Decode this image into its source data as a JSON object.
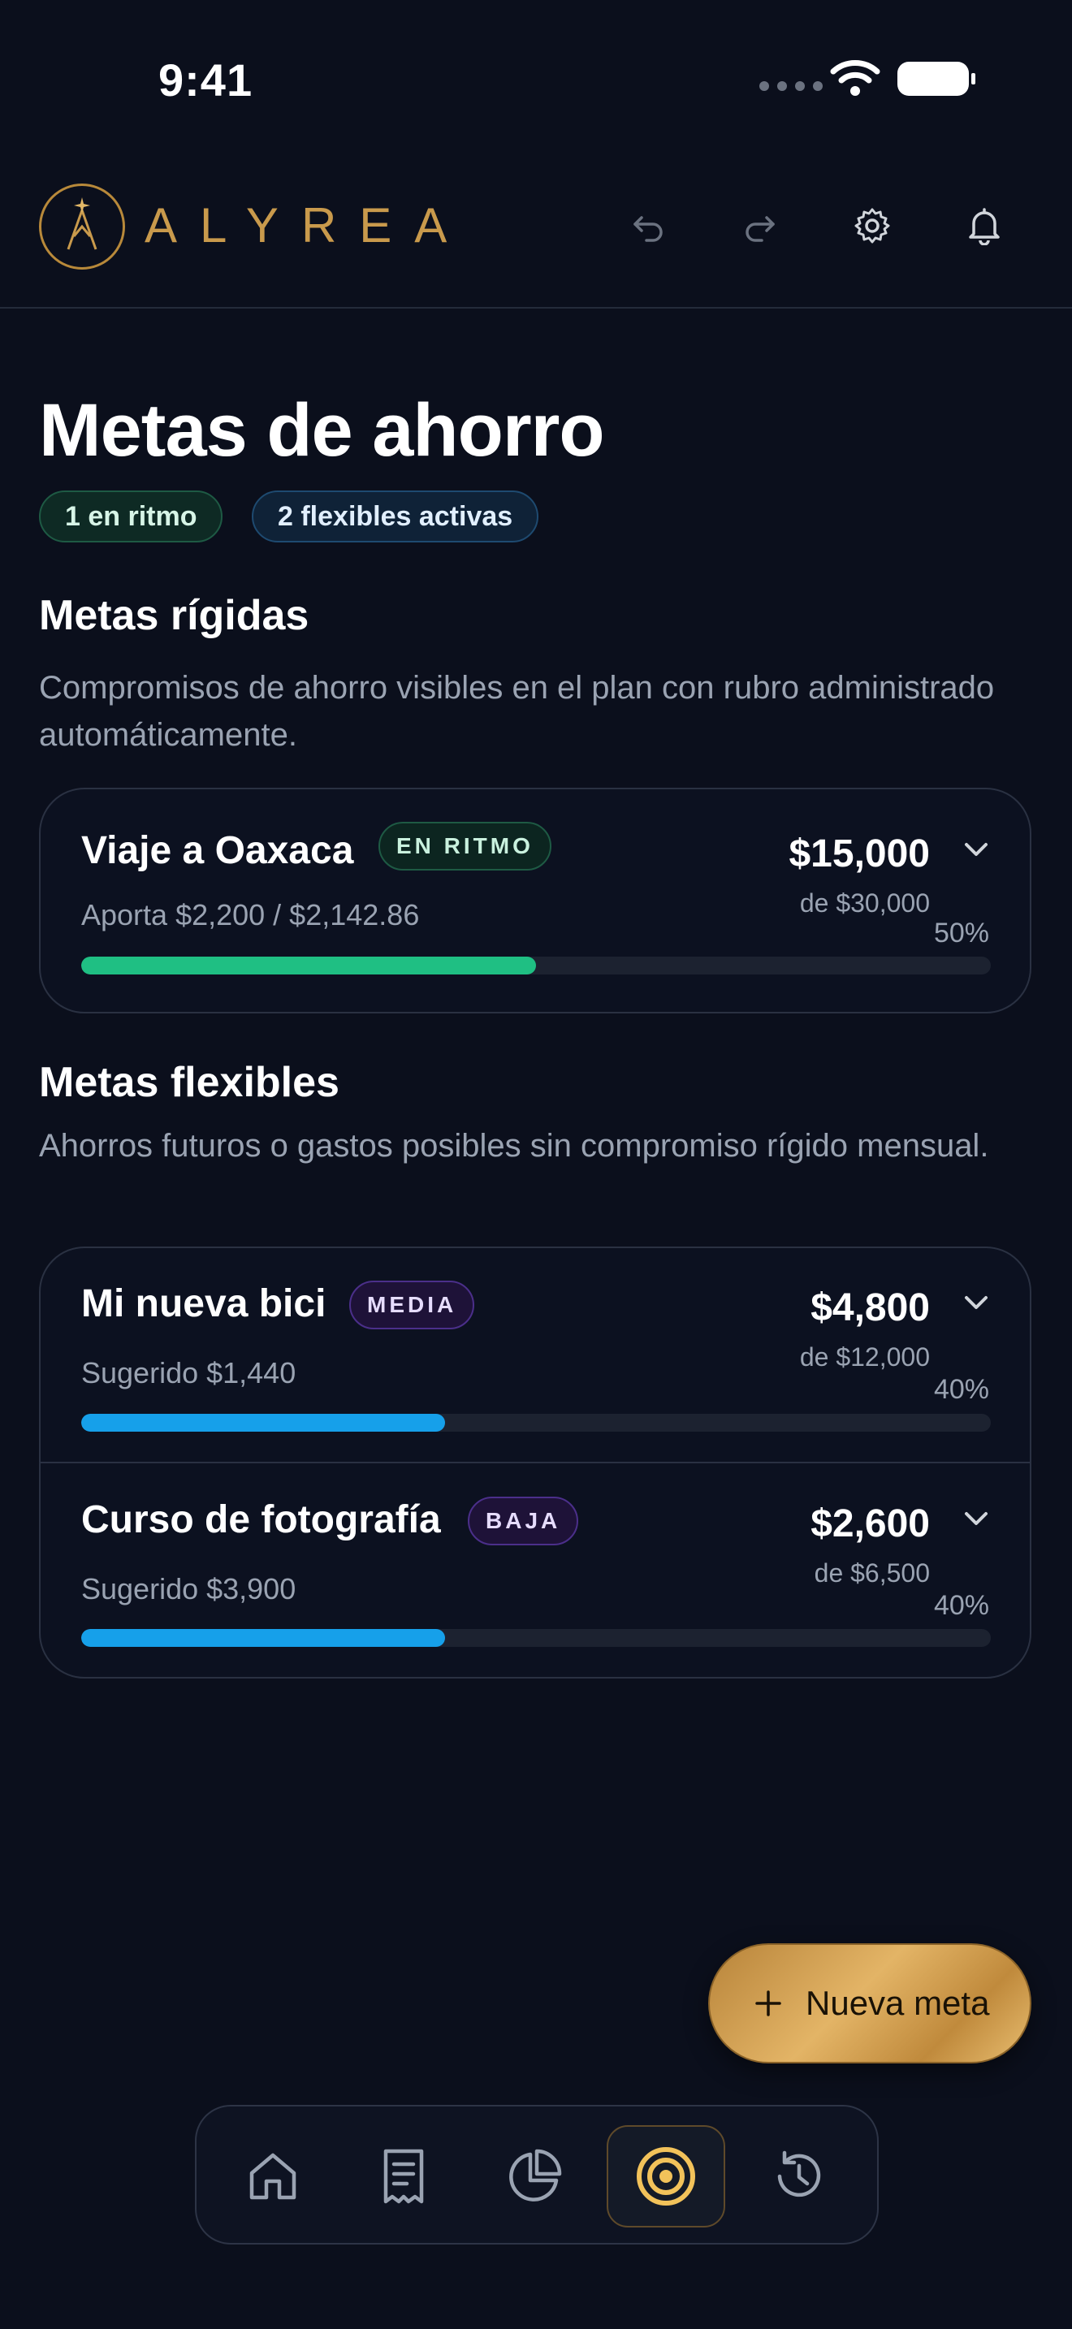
{
  "status_bar": {
    "time": "9:41"
  },
  "header": {
    "brand": "ALYREA"
  },
  "page": {
    "title": "Metas de ahorro",
    "chips": {
      "on_track": "1 en ritmo",
      "flexible_active": "2 flexibles activas"
    }
  },
  "rigid": {
    "title": "Metas rígidas",
    "description": "Compromisos de ahorro visibles en el plan con rubro administrado automáticamente.",
    "goals": [
      {
        "name": "Viaje a Oaxaca",
        "badge": "EN RITMO",
        "detail": "Aporta $2,200 / $2,142.86",
        "amount": "$15,000",
        "target": "de $30,000",
        "percent": "50%",
        "progress": 0.5,
        "bar_color": "#1fbf83"
      }
    ]
  },
  "flexible": {
    "title": "Metas flexibles",
    "description": "Ahorros futuros o gastos posibles sin compromiso rígido mensual.",
    "goals": [
      {
        "name": "Mi nueva bici",
        "badge": "MEDIA",
        "detail": "Sugerido $1,440",
        "amount": "$4,800",
        "target": "de $12,000",
        "percent": "40%",
        "progress": 0.4,
        "bar_color": "#16a0ea"
      },
      {
        "name": "Curso de fotografía",
        "badge": "BAJA",
        "detail": "Sugerido $3,900",
        "amount": "$2,600",
        "target": "de $6,500",
        "percent": "40%",
        "progress": 0.4,
        "bar_color": "#16a0ea"
      }
    ]
  },
  "fab": {
    "label": "Nueva meta"
  },
  "nav": {
    "active": "goals"
  },
  "colors": {
    "accent_gold": "#c99a4c",
    "on_track_green": "#1fbf83",
    "progress_blue": "#16a0ea",
    "background": "#0b0f1c"
  }
}
